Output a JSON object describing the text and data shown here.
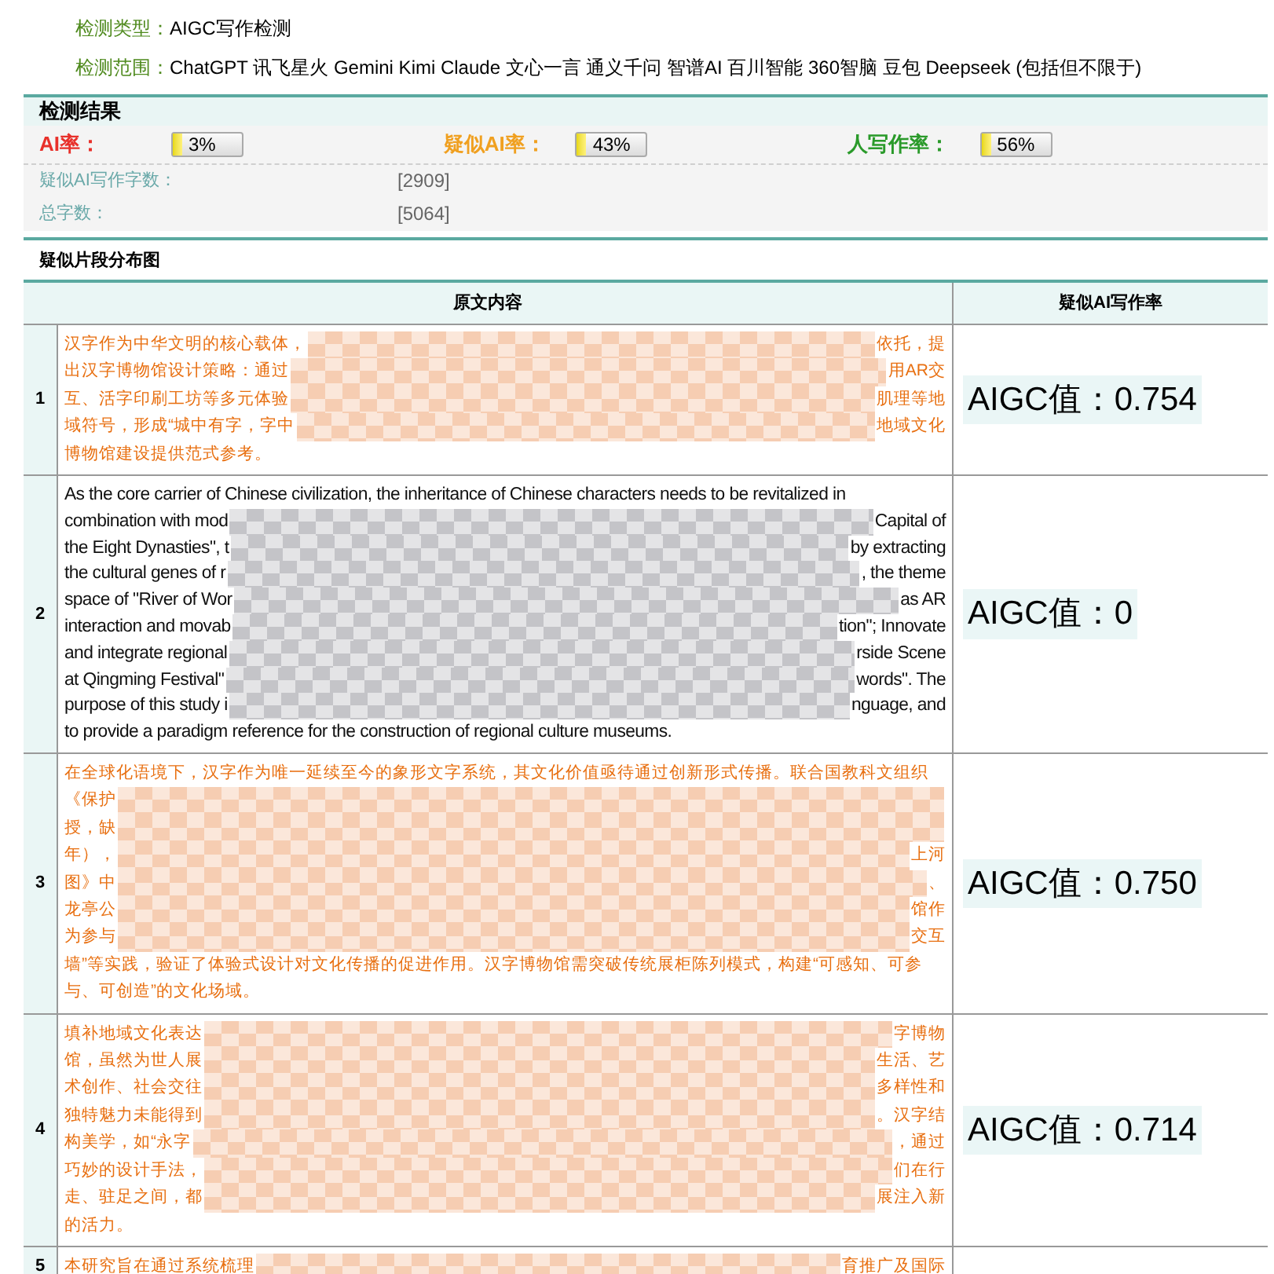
{
  "info": [
    {
      "label": "检测类型：",
      "value": "AIGC写作检测"
    },
    {
      "label": "检测范围：",
      "value": "ChatGPT 讯飞星火 Gemini Kimi Claude 文心一言 通义千问 智谱AI 百川智能 360智脑 豆包 Deepseek (包括但不限于)"
    }
  ],
  "results": {
    "title": "检测结果",
    "rates": [
      {
        "label": "AI率：",
        "value": "3%",
        "color": "#e8302a"
      },
      {
        "label": "疑似AI率：",
        "value": "43%",
        "color": "#f0a020"
      },
      {
        "label": "人写作率：",
        "value": "56%",
        "color": "#2a9a2a"
      }
    ],
    "stats": [
      {
        "label": "疑似AI写作字数：",
        "value": "[2909]"
      },
      {
        "label": "总字数：",
        "value": "[5064]"
      }
    ]
  },
  "distribution": {
    "title": "疑似片段分布图",
    "columns": [
      "原文内容",
      "疑似AI写作率"
    ],
    "rows": [
      {
        "index": "1",
        "highlighted": true,
        "value": "AIGC值：0.754",
        "lines": [
          {
            "left": "汉字作为中华文明的核心载体，",
            "right": "依托，提",
            "redacted": true
          },
          {
            "left": "出汉字博物馆设计策略：通过",
            "right": "用AR交",
            "redacted": true
          },
          {
            "left": "互、活字印刷工坊等多元体验",
            "right": "肌理等地",
            "redacted": true
          },
          {
            "left": "域符号，形成“城中有字，字中",
            "right": "地域文化",
            "redacted": true
          },
          {
            "left": "博物馆建设提供范式参考。",
            "redacted": false
          }
        ]
      },
      {
        "index": "2",
        "highlighted": false,
        "value": "AIGC值：0",
        "lines": [
          {
            "left": "As the core carrier of Chinese civilization, the inheritance of Chinese characters needs to be revitalized in",
            "redacted": false
          },
          {
            "left": "combination with mod",
            "right": "Capital of",
            "redacted": true
          },
          {
            "left": "the Eight Dynasties\", t",
            "right": "by extracting",
            "redacted": true
          },
          {
            "left": "the cultural genes of r",
            "right": ", the theme",
            "redacted": true
          },
          {
            "left": "space of \"River of Wor",
            "right": "as AR",
            "redacted": true
          },
          {
            "left": "interaction and movab",
            "right": "tion\"; Innovate",
            "redacted": true
          },
          {
            "left": "and integrate regional",
            "right": "rside Scene",
            "redacted": true
          },
          {
            "left": "at Qingming Festival\"",
            "right": "words\". The",
            "redacted": true
          },
          {
            "left": "purpose of this study i",
            "right": "nguage, and",
            "redacted": true
          },
          {
            "left": "to provide a paradigm reference for the construction of regional culture museums.",
            "redacted": false
          }
        ]
      },
      {
        "index": "3",
        "highlighted": true,
        "value": "AIGC值：0.750",
        "lines": [
          {
            "left": "在全球化语境下，汉字作为唯一延续至今的象形文字系统，其文化价值亟待通过创新形式传播。联合国教科文组织",
            "redacted": false
          },
          {
            "left": "《保护",
            "redacted": true
          },
          {
            "left": "授，缺",
            "redacted": true
          },
          {
            "left": "年），",
            "right": "上河",
            "redacted": true
          },
          {
            "left": "图》中",
            "right": "、",
            "redacted": true
          },
          {
            "left": "龙亭公",
            "right": "馆作",
            "redacted": true
          },
          {
            "left": "为参与",
            "right": "交互",
            "redacted": true
          },
          {
            "left": "墙”等实践，验证了体验式设计对文化传播的促进作用。汉字博物馆需突破传统展柜陈列模式，构建“可感知、可参",
            "redacted": false
          },
          {
            "left": "与、可创造”的文化场域。",
            "redacted": false
          }
        ]
      },
      {
        "index": "4",
        "highlighted": true,
        "value": "AIGC值：0.714",
        "lines": [
          {
            "left": "填补地域文化表达",
            "right": "字博物",
            "redacted": true
          },
          {
            "left": "馆，虽然为世人展",
            "right": "生活、艺",
            "redacted": true
          },
          {
            "left": "术创作、社会交往",
            "right": "多样性和",
            "redacted": true
          },
          {
            "left": "独特魅力未能得到",
            "right": "。汉字结",
            "redacted": true
          },
          {
            "left": "构美学，如“永字",
            "right": "，通过",
            "redacted": true
          },
          {
            "left": "巧妙的设计手法，",
            "right": "们在行",
            "redacted": true
          },
          {
            "left": "走、驻足之间，都",
            "right": "展注入新",
            "redacted": true
          },
          {
            "left": "的活力。",
            "redacted": false
          }
        ]
      },
      {
        "index": "5",
        "highlighted": true,
        "lines": [
          {
            "left": "本研究旨在通过系统梳理",
            "right": "育推广及国际",
            "redacted": true
          }
        ]
      }
    ]
  }
}
